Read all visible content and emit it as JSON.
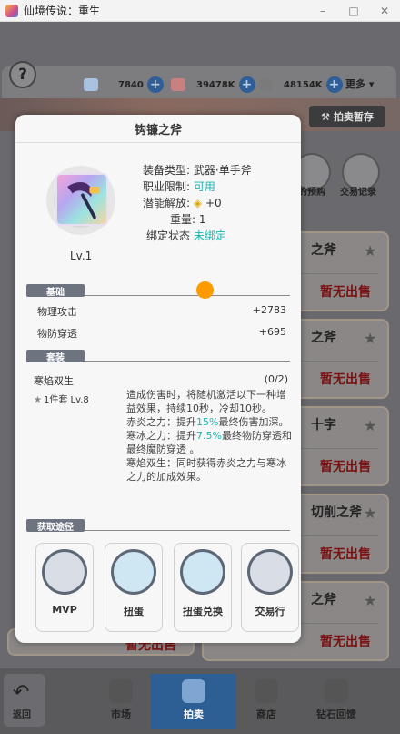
{
  "window": {
    "title": "仙境传说：重生"
  },
  "resources": [
    {
      "name": "diamond",
      "value": "7840",
      "color": "#a9c2e0"
    },
    {
      "name": "ruby",
      "value": "39478K",
      "color": "#c98080"
    },
    {
      "name": "coin",
      "value": "48154K",
      "color": "#7a7a7a"
    }
  ],
  "topbar": {
    "more": "更多",
    "auction_temp": "拍卖暂存"
  },
  "side_buttons": [
    {
      "label": "的预购"
    },
    {
      "label": "交易记录"
    }
  ],
  "listings": [
    {
      "name": "之斧",
      "status": "暂无出售"
    },
    {
      "name": "之斧",
      "status": "暂无出售"
    },
    {
      "name": "十字",
      "status": "暂无出售"
    },
    {
      "name": "切削之斧",
      "status": "暂无出售"
    },
    {
      "name": "之斧",
      "status": "暂无出售"
    },
    {
      "name": "",
      "status": "暂无出售"
    }
  ],
  "bottom_nav": {
    "back": "返回",
    "items": [
      {
        "label": "市场",
        "active": false
      },
      {
        "label": "拍卖",
        "active": true
      },
      {
        "label": "商店",
        "active": false
      },
      {
        "label": "钻石回馈",
        "active": false
      }
    ]
  },
  "popup": {
    "title": "钩镰之斧",
    "level": "Lv.1",
    "equip_type_label": "装备类型:",
    "equip_type_value": "武器·单手斧",
    "job_limit_label": "职业限制:",
    "job_limit_value": "可用",
    "potential_label": "潜能解放:",
    "potential_value": "+0",
    "weight_label": "重量:",
    "weight_value": "1",
    "bind_label": "绑定状态",
    "bind_value": "未绑定",
    "section_basic": "基础",
    "stats": [
      {
        "label": "物理攻击",
        "value": "+2783"
      },
      {
        "label": "物防穿透",
        "value": "+695"
      }
    ],
    "section_set": "套装",
    "set_name": "寒焰双生",
    "set_count": "(0/2)",
    "set_piece": "1件套 Lv.8",
    "set_desc": [
      {
        "text": "造成伤害时，将随机激活以下一种增益效果，持续10秒，冷却10秒。"
      },
      {
        "pre": "赤炎之力：提升",
        "hl": "15%",
        "post": "最终伤害加深。"
      },
      {
        "pre": "寒冰之力：提升",
        "hl": "7.5%",
        "post": "最终物防穿透和最终魔防穿透 。"
      },
      {
        "text": "寒焰双生：同时获得赤炎之力与寒冰之力的加成效果。"
      }
    ],
    "section_source": "获取途径",
    "sources": [
      {
        "label": "MVP",
        "icon": "mvp-icon"
      },
      {
        "label": "扭蛋",
        "icon": "gacha-icon"
      },
      {
        "label": "扭蛋兑换",
        "icon": "gacha-exchange-icon"
      },
      {
        "label": "交易行",
        "icon": "trade-icon"
      }
    ]
  },
  "colors": {
    "accent": "#1bb5b5",
    "active_nav": "#2e5f94",
    "status_red": "#7a1010",
    "indicator": "#ff9a00"
  }
}
